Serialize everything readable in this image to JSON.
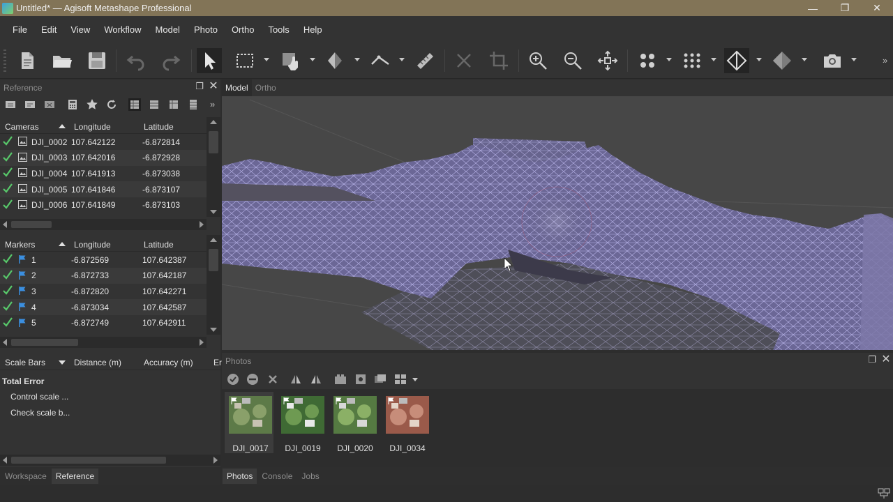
{
  "window": {
    "title": "Untitled* — Agisoft Metashape Professional",
    "controls": {
      "minimize": "—",
      "restore": "❐",
      "close": "✕"
    }
  },
  "menu": [
    "File",
    "Edit",
    "View",
    "Workflow",
    "Model",
    "Photo",
    "Ortho",
    "Tools",
    "Help"
  ],
  "reference_panel": {
    "title": "Reference",
    "cameras": {
      "headers": [
        "Cameras",
        "Longitude",
        "Latitude"
      ],
      "rows": [
        {
          "name": "DJI_0002",
          "lon": "107.642122",
          "lat": "-6.872814"
        },
        {
          "name": "DJI_0003",
          "lon": "107.642016",
          "lat": "-6.872928"
        },
        {
          "name": "DJI_0004",
          "lon": "107.641913",
          "lat": "-6.873038"
        },
        {
          "name": "DJI_0005",
          "lon": "107.641846",
          "lat": "-6.873107"
        },
        {
          "name": "DJI_0006",
          "lon": "107.641849",
          "lat": "-6.873103"
        }
      ]
    },
    "markers": {
      "headers": [
        "Markers",
        "Longitude",
        "Latitude"
      ],
      "rows": [
        {
          "name": "1",
          "lon": "-6.872569",
          "lat": "107.642387"
        },
        {
          "name": "2",
          "lon": "-6.872733",
          "lat": "107.642187"
        },
        {
          "name": "3",
          "lon": "-6.872820",
          "lat": "107.642271"
        },
        {
          "name": "4",
          "lon": "-6.873034",
          "lat": "107.642587"
        },
        {
          "name": "5",
          "lon": "-6.872749",
          "lat": "107.642911"
        }
      ]
    },
    "scale_bars": {
      "headers": [
        "Scale Bars",
        "Distance (m)",
        "Accuracy (m)",
        "Er"
      ],
      "total_error": "Total Error",
      "items": [
        "Control scale ...",
        "Check scale b..."
      ]
    }
  },
  "left_tabs": [
    "Workspace",
    "Reference"
  ],
  "viewport": {
    "tabs": [
      "Model",
      "Ortho"
    ]
  },
  "photos_panel": {
    "title": "Photos",
    "photos": [
      "DJI_0017",
      "DJI_0019",
      "DJI_0020",
      "DJI_0034"
    ]
  },
  "bottom_tabs": [
    "Photos",
    "Console",
    "Jobs"
  ],
  "colors": {
    "mesh": "#8d86c9",
    "titlebar": "#827457",
    "check": "#58c86a",
    "marker_flag": "#3b8fe0"
  }
}
